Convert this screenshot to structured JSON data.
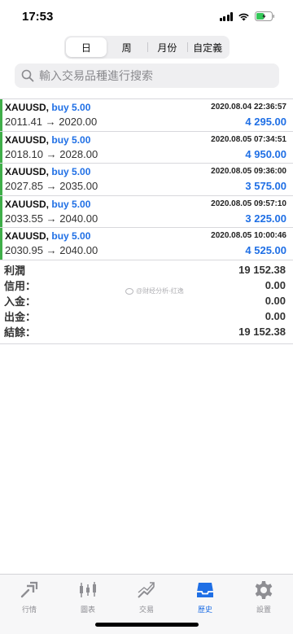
{
  "status": {
    "time": "17:53"
  },
  "period_tabs": [
    "日",
    "周",
    "月份",
    "自定義"
  ],
  "period_active": "日",
  "search": {
    "placeholder": "輸入交易品種進行搜索"
  },
  "trades": [
    {
      "symbol": "XAUUSD,",
      "side": "buy 5.00",
      "datetime": "2020.08.04 22:36:57",
      "prices": "2011.41 → 2020.00",
      "profit": "4 295.00"
    },
    {
      "symbol": "XAUUSD,",
      "side": "buy 5.00",
      "datetime": "2020.08.05 07:34:51",
      "prices": "2018.10 → 2028.00",
      "profit": "4 950.00"
    },
    {
      "symbol": "XAUUSD,",
      "side": "buy 5.00",
      "datetime": "2020.08.05 09:36:00",
      "prices": "2027.85 → 2035.00",
      "profit": "3 575.00"
    },
    {
      "symbol": "XAUUSD,",
      "side": "buy 5.00",
      "datetime": "2020.08.05 09:57:10",
      "prices": "2033.55 → 2040.00",
      "profit": "3 225.00"
    },
    {
      "symbol": "XAUUSD,",
      "side": "buy 5.00",
      "datetime": "2020.08.05 10:00:46",
      "prices": "2030.95 → 2040.00",
      "profit": "4 525.00"
    }
  ],
  "summary": [
    {
      "label": "利潤",
      "value": "19 152.38"
    },
    {
      "label": "信用：",
      "value": "0.00"
    },
    {
      "label": "入金：",
      "value": "0.00"
    },
    {
      "label": "出金：",
      "value": "0.00"
    },
    {
      "label": "結餘：",
      "value": "19 152.38"
    }
  ],
  "watermark": "@财经分析-红逸",
  "tabs": [
    {
      "label": "行情",
      "icon": "quotes-icon",
      "active": false
    },
    {
      "label": "圖表",
      "icon": "chart-icon",
      "active": false
    },
    {
      "label": "交易",
      "icon": "trade-icon",
      "active": false
    },
    {
      "label": "歷史",
      "icon": "history-icon",
      "active": true
    },
    {
      "label": "設置",
      "icon": "settings-icon",
      "active": false
    }
  ],
  "colors": {
    "accent": "#1f6fe5",
    "buy_bar": "#3fae49",
    "inactive_tab": "#8e8e93"
  }
}
